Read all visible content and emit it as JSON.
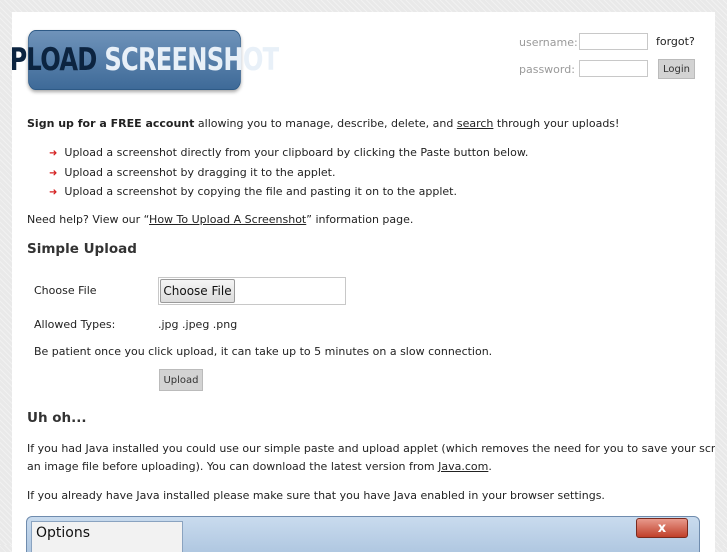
{
  "logo": {
    "word1": "UPLOAD",
    "word2": "SCREENSHOT"
  },
  "login": {
    "username_label": "username:",
    "password_label": "password:",
    "forgot": "forgot?",
    "login_button": "Login"
  },
  "intro": {
    "signup_bold": "Sign up for a FREE account",
    "signup_mid": " allowing you to manage, describe, delete, and ",
    "signup_link": "search",
    "signup_end": " through your uploads!",
    "bullets": [
      "Upload a screenshot directly from your clipboard by clicking the Paste button below.",
      "Upload a screenshot by dragging it to the applet.",
      "Upload a screenshot by copying the file and pasting it on to the applet."
    ],
    "help_start": "Need help? View our “",
    "help_link": "How To Upload A Screenshot",
    "help_end": "” information page."
  },
  "simple_upload": {
    "heading": "Simple Upload",
    "choose_label": "Choose File",
    "choose_button": "Choose File",
    "types_label": "Allowed Types:",
    "types_value": ".jpg .jpeg .png",
    "patience": "Be patient once you click upload, it can take up to 5 minutes on a slow connection.",
    "upload_button": "Upload"
  },
  "uh_oh": {
    "heading": "Uh oh...",
    "line1": "If you had Java installed you could use our simple paste and upload applet (which removes the need for you to save your screenshots to",
    "line2_start": "an image file before uploading). You can download the latest version from ",
    "line2_link": "Java.com",
    "line2_end": ".",
    "line3": "If you already have Java installed please make sure that you have Java enabled in your browser settings."
  },
  "options_window": {
    "title": "Options",
    "close": "x"
  }
}
